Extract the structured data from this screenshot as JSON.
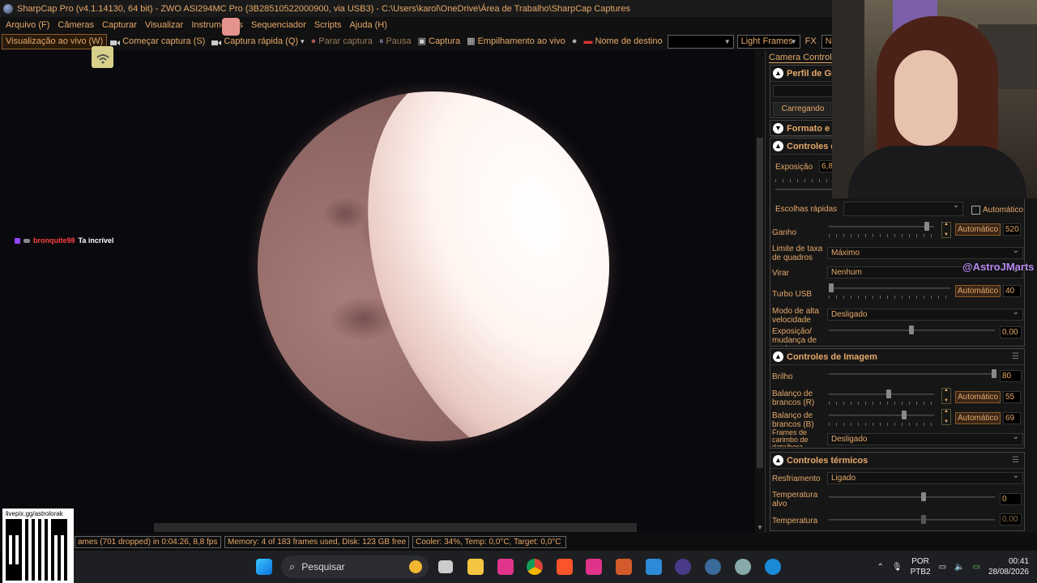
{
  "window": {
    "title": "SharpCap Pro (v4.1.14130, 64 bit) - ZWO ASI294MC Pro (3B28510522000900, via USB3) - C:\\Users\\karol\\OneDrive\\Área de Trabalho\\SharpCap Captures"
  },
  "menu": [
    "Arquivo (F)",
    "Câmeras",
    "Capturar",
    "Visualizar",
    "Instrumentos",
    "Sequenciador",
    "Scripts",
    "Ajuda (H)"
  ],
  "toolbar": {
    "live_view": "Visualização ao vivo (W)",
    "start_capture": "Começar captura (S)",
    "quick_capture": "Captura rápida (Q)",
    "stop_capture": "Parar captura",
    "pause": "Pausa",
    "snapshot": "Captura",
    "live_stack": "Empilhamento ao vivo",
    "target_name": "Nome de destino",
    "target_value": "",
    "frame_type": "Light Frames",
    "fx_label": "FX",
    "fx_value": "Nenhum"
  },
  "chat": {
    "user": "bronquite98",
    "message": "Ta incrível"
  },
  "panel": {
    "tab": "Camera Controls",
    "profile": {
      "title": "Perfil de Gra",
      "loading": "Carregando"
    },
    "format": {
      "title": "Formato e Á"
    },
    "camera_controls": {
      "title": "Controles da",
      "exposure_label": "Exposição",
      "exposure_value": "6,8",
      "quick_label": "Escolhas rápidas",
      "auto_label": "Automático",
      "gain_label": "Ganho",
      "gain_auto": "Automático",
      "gain_value": "520",
      "frame_rate_label": "Limite de taxa de quadros",
      "frame_rate_value": "Máximo",
      "flip_label": "Virar",
      "flip_value": "Nenhum",
      "usb_label": "Turbo USB",
      "usb_auto": "Automático",
      "usb_value": "40",
      "hs_label": "Modo de alta velocidade",
      "hs_value": "Desligado",
      "exp_change_label": "Exposição/ mudança de ganho",
      "exp_change_value": "0,00"
    },
    "image_controls": {
      "title": "Controles de Imagem",
      "brightness_label": "Brilho",
      "brightness_value": "80",
      "wb_r_label": "Balanço de brancos (R)",
      "wb_r_auto": "Automático",
      "wb_r_value": "55",
      "wb_b_label": "Balanço de brancos (B)",
      "wb_b_auto": "Automático",
      "wb_b_value": "69",
      "timestamp_label": "Frames de carimbo de data/hora",
      "timestamp_value": "Desligado"
    },
    "thermal": {
      "title": "Controles térmicos",
      "cooling_label": "Resfriamento",
      "cooling_value": "Ligado",
      "target_temp_label": "Temperatura alvo",
      "target_temp_value": "0",
      "temp_label": "Temperatura",
      "temp_value": "0,00"
    }
  },
  "watermark": "@AstroJMarts",
  "status": {
    "frames": "ames (701 dropped) in 0:04:26, 8,8 fps",
    "memory": "Memory: 4 of 183 frames used, Disk: 123 GB free",
    "cooler": "Cooler: 34%, Temp: 0,0°C, Target: 0,0°C"
  },
  "qr": {
    "label": "livepix.gg/astrolorak"
  },
  "taskbar": {
    "search": "Pesquisar",
    "lang": "POR",
    "layout": "PTB2",
    "time": "00:41",
    "date": "28/08/2026"
  },
  "colors": {
    "accent": "#e6a96a",
    "background": "#000000",
    "watermark": "#b98cf2"
  }
}
